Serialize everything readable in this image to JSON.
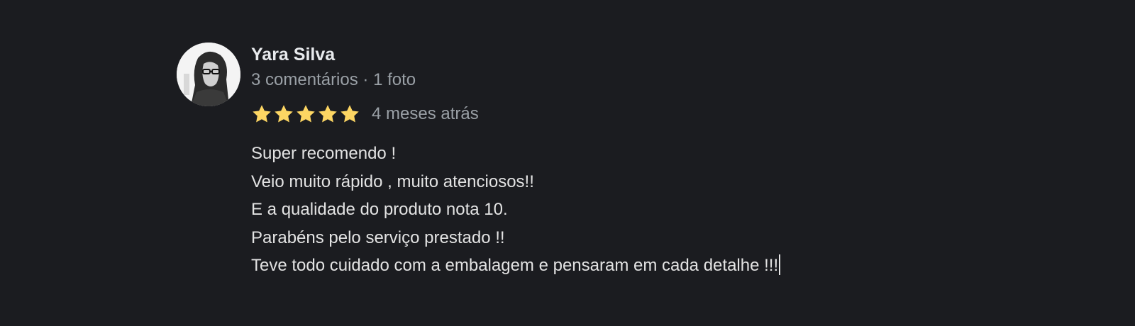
{
  "review": {
    "author": {
      "name": "Yara Silva",
      "meta": "3 comentários · 1 foto"
    },
    "rating": {
      "stars": 5,
      "max": 5,
      "color": "#fdd663"
    },
    "date": "4 meses atrás",
    "text_lines": [
      "Super recomendo !",
      "Veio muito rápido , muito atenciosos!!",
      "E a qualidade do produto nota 10.",
      "Parabéns pelo serviço prestado !!",
      "Teve todo cuidado com a embalagem e pensaram em cada detalhe !!!"
    ]
  },
  "colors": {
    "background": "#1b1c20",
    "text_primary": "#e3e3e3",
    "text_secondary": "#9aa0a6",
    "star": "#fdd663"
  }
}
